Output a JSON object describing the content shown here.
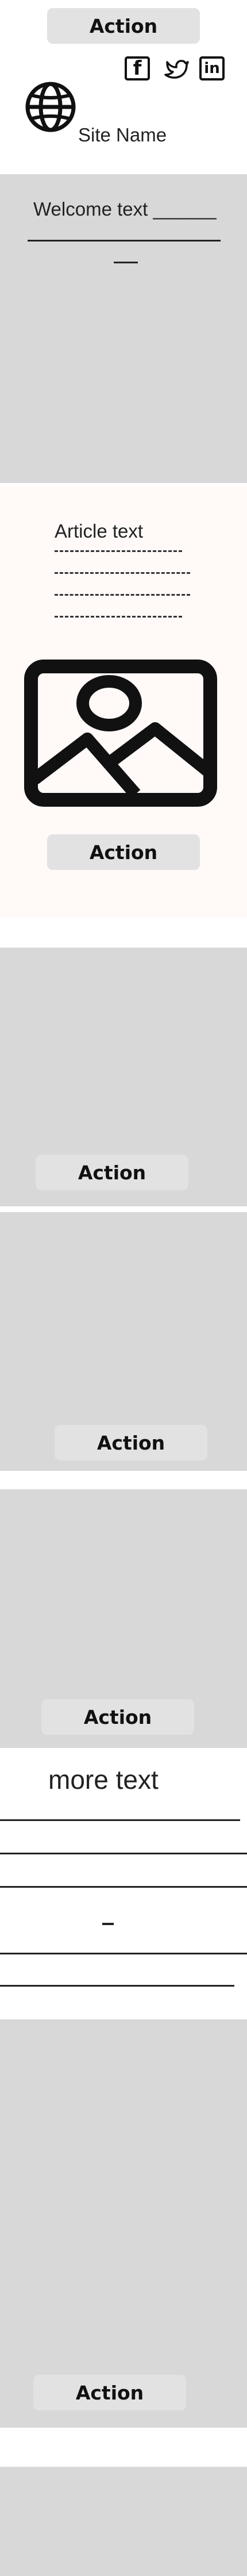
{
  "header": {
    "action_label": "Action",
    "site_name": "Site Name",
    "social": {
      "facebook": "f",
      "linkedin": "in"
    }
  },
  "welcome": {
    "text": "Welcome text ______"
  },
  "article": {
    "text": "Article text",
    "action_label": "Action"
  },
  "cards": [
    {
      "action_label": "Action"
    },
    {
      "action_label": "Action"
    },
    {
      "action_label": "Action"
    }
  ],
  "more": {
    "text": "more text"
  },
  "big_section": {
    "action_label": "Action"
  },
  "icons": {
    "logo": "globe-icon",
    "facebook": "facebook-icon",
    "twitter": "twitter-icon",
    "linkedin": "linkedin-icon",
    "image": "image-placeholder-icon"
  },
  "colors": {
    "section_gray": "#d8d8d8",
    "button_gray": "#e2e2e2",
    "article_bg": "#fff9f8"
  }
}
